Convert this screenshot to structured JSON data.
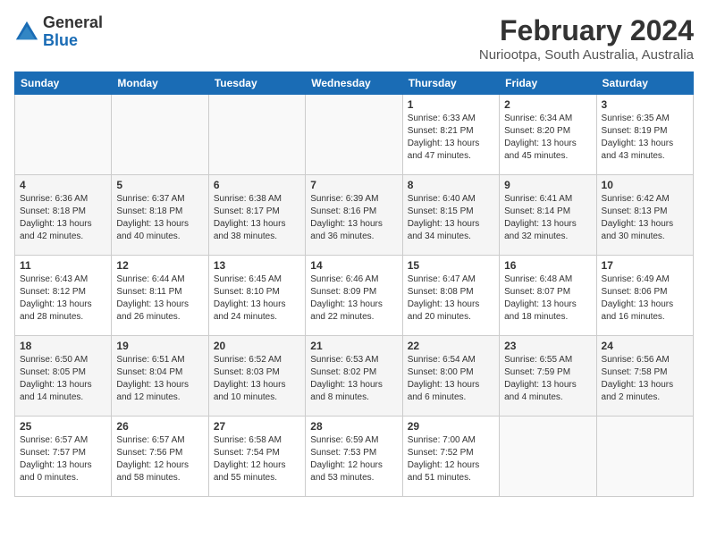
{
  "header": {
    "logo_line1": "General",
    "logo_line2": "Blue",
    "title": "February 2024",
    "subtitle": "Nuriootpa, South Australia, Australia"
  },
  "days_of_week": [
    "Sunday",
    "Monday",
    "Tuesday",
    "Wednesday",
    "Thursday",
    "Friday",
    "Saturday"
  ],
  "weeks": [
    [
      {
        "day": "",
        "info": ""
      },
      {
        "day": "",
        "info": ""
      },
      {
        "day": "",
        "info": ""
      },
      {
        "day": "",
        "info": ""
      },
      {
        "day": "1",
        "info": "Sunrise: 6:33 AM\nSunset: 8:21 PM\nDaylight: 13 hours\nand 47 minutes."
      },
      {
        "day": "2",
        "info": "Sunrise: 6:34 AM\nSunset: 8:20 PM\nDaylight: 13 hours\nand 45 minutes."
      },
      {
        "day": "3",
        "info": "Sunrise: 6:35 AM\nSunset: 8:19 PM\nDaylight: 13 hours\nand 43 minutes."
      }
    ],
    [
      {
        "day": "4",
        "info": "Sunrise: 6:36 AM\nSunset: 8:18 PM\nDaylight: 13 hours\nand 42 minutes."
      },
      {
        "day": "5",
        "info": "Sunrise: 6:37 AM\nSunset: 8:18 PM\nDaylight: 13 hours\nand 40 minutes."
      },
      {
        "day": "6",
        "info": "Sunrise: 6:38 AM\nSunset: 8:17 PM\nDaylight: 13 hours\nand 38 minutes."
      },
      {
        "day": "7",
        "info": "Sunrise: 6:39 AM\nSunset: 8:16 PM\nDaylight: 13 hours\nand 36 minutes."
      },
      {
        "day": "8",
        "info": "Sunrise: 6:40 AM\nSunset: 8:15 PM\nDaylight: 13 hours\nand 34 minutes."
      },
      {
        "day": "9",
        "info": "Sunrise: 6:41 AM\nSunset: 8:14 PM\nDaylight: 13 hours\nand 32 minutes."
      },
      {
        "day": "10",
        "info": "Sunrise: 6:42 AM\nSunset: 8:13 PM\nDaylight: 13 hours\nand 30 minutes."
      }
    ],
    [
      {
        "day": "11",
        "info": "Sunrise: 6:43 AM\nSunset: 8:12 PM\nDaylight: 13 hours\nand 28 minutes."
      },
      {
        "day": "12",
        "info": "Sunrise: 6:44 AM\nSunset: 8:11 PM\nDaylight: 13 hours\nand 26 minutes."
      },
      {
        "day": "13",
        "info": "Sunrise: 6:45 AM\nSunset: 8:10 PM\nDaylight: 13 hours\nand 24 minutes."
      },
      {
        "day": "14",
        "info": "Sunrise: 6:46 AM\nSunset: 8:09 PM\nDaylight: 13 hours\nand 22 minutes."
      },
      {
        "day": "15",
        "info": "Sunrise: 6:47 AM\nSunset: 8:08 PM\nDaylight: 13 hours\nand 20 minutes."
      },
      {
        "day": "16",
        "info": "Sunrise: 6:48 AM\nSunset: 8:07 PM\nDaylight: 13 hours\nand 18 minutes."
      },
      {
        "day": "17",
        "info": "Sunrise: 6:49 AM\nSunset: 8:06 PM\nDaylight: 13 hours\nand 16 minutes."
      }
    ],
    [
      {
        "day": "18",
        "info": "Sunrise: 6:50 AM\nSunset: 8:05 PM\nDaylight: 13 hours\nand 14 minutes."
      },
      {
        "day": "19",
        "info": "Sunrise: 6:51 AM\nSunset: 8:04 PM\nDaylight: 13 hours\nand 12 minutes."
      },
      {
        "day": "20",
        "info": "Sunrise: 6:52 AM\nSunset: 8:03 PM\nDaylight: 13 hours\nand 10 minutes."
      },
      {
        "day": "21",
        "info": "Sunrise: 6:53 AM\nSunset: 8:02 PM\nDaylight: 13 hours\nand 8 minutes."
      },
      {
        "day": "22",
        "info": "Sunrise: 6:54 AM\nSunset: 8:00 PM\nDaylight: 13 hours\nand 6 minutes."
      },
      {
        "day": "23",
        "info": "Sunrise: 6:55 AM\nSunset: 7:59 PM\nDaylight: 13 hours\nand 4 minutes."
      },
      {
        "day": "24",
        "info": "Sunrise: 6:56 AM\nSunset: 7:58 PM\nDaylight: 13 hours\nand 2 minutes."
      }
    ],
    [
      {
        "day": "25",
        "info": "Sunrise: 6:57 AM\nSunset: 7:57 PM\nDaylight: 13 hours\nand 0 minutes."
      },
      {
        "day": "26",
        "info": "Sunrise: 6:57 AM\nSunset: 7:56 PM\nDaylight: 12 hours\nand 58 minutes."
      },
      {
        "day": "27",
        "info": "Sunrise: 6:58 AM\nSunset: 7:54 PM\nDaylight: 12 hours\nand 55 minutes."
      },
      {
        "day": "28",
        "info": "Sunrise: 6:59 AM\nSunset: 7:53 PM\nDaylight: 12 hours\nand 53 minutes."
      },
      {
        "day": "29",
        "info": "Sunrise: 7:00 AM\nSunset: 7:52 PM\nDaylight: 12 hours\nand 51 minutes."
      },
      {
        "day": "",
        "info": ""
      },
      {
        "day": "",
        "info": ""
      }
    ]
  ]
}
